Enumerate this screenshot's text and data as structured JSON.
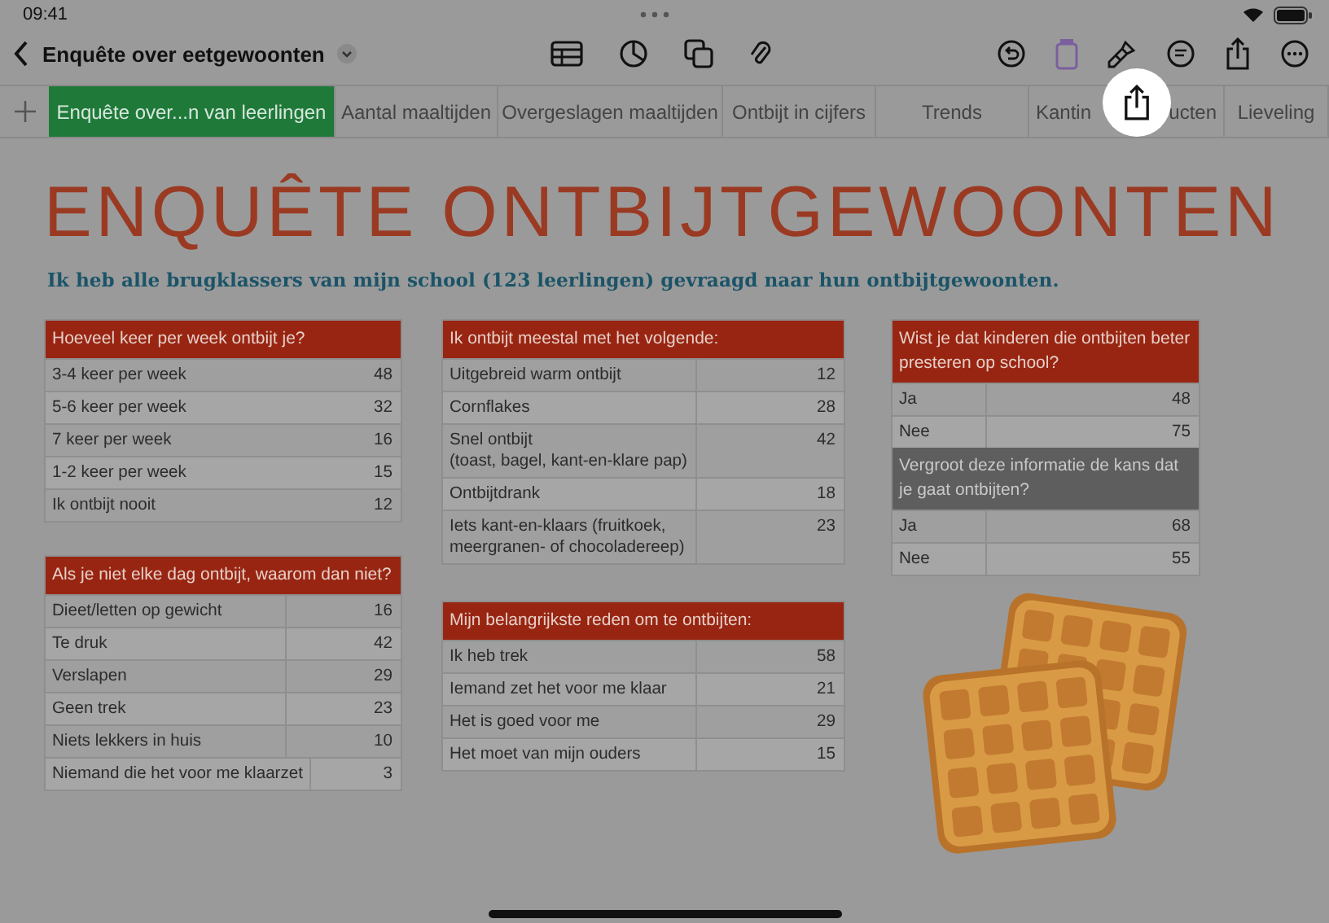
{
  "status_bar": {
    "time": "09:41"
  },
  "toolbar": {
    "title": "Enquête over eetgewoonten",
    "share_highlighted": true
  },
  "sheet_tabs": [
    {
      "label": "Enquête over...n van leerlingen",
      "selected": true
    },
    {
      "label": "Aantal maaltijden",
      "selected": false
    },
    {
      "label": "Overgeslagen maaltijden",
      "selected": false
    },
    {
      "label": "Ontbijt in cijfers",
      "selected": false
    },
    {
      "label": "Trends",
      "selected": false
    },
    {
      "label": "Kantin",
      "label_end": "ucten",
      "selected": false
    },
    {
      "label": "Lieveling",
      "selected": false
    }
  ],
  "title": "ENQUÊTE ONTBIJTGEWOONTEN",
  "subtitle": "Ik heb alle brugklassers van mijn school (123 leerlingen) gevraagd naar hun ontbijtgewoonten.",
  "columns": [
    [
      {
        "divided": false,
        "sections": [
          {
            "header": "Hoeveel keer per week ontbijt je?",
            "kind": "accent",
            "rows": [
              {
                "label": "3-4 keer per week",
                "value": "48"
              },
              {
                "label": "5-6 keer per week",
                "value": "32"
              },
              {
                "label": "7 keer per week",
                "value": "16"
              },
              {
                "label": "1-2 keer per week",
                "value": "15"
              },
              {
                "label": "Ik ontbijt nooit",
                "value": "12"
              }
            ]
          }
        ]
      },
      {
        "divided": true,
        "sections": [
          {
            "header": "Als je niet elke dag ontbijt, waarom dan niet?",
            "kind": "accent",
            "rows": [
              {
                "label": "Dieet/letten op gewicht",
                "value": "16"
              },
              {
                "label": "Te druk",
                "value": "42"
              },
              {
                "label": "Verslapen",
                "value": "29"
              },
              {
                "label": "Geen trek",
                "value": "23"
              },
              {
                "label": "Niets lekkers in huis",
                "value": "10"
              },
              {
                "label": "Niemand die het voor me klaarzet",
                "value": "3"
              }
            ]
          }
        ]
      }
    ],
    [
      {
        "divided": true,
        "sections": [
          {
            "header": "Ik ontbijt meestal met het volgende:",
            "kind": "accent",
            "rows": [
              {
                "label": "Uitgebreid warm ontbijt",
                "value": "12"
              },
              {
                "label": "Cornflakes",
                "value": "28"
              },
              {
                "label": "Snel ontbijt\n(toast, bagel, kant-en-klare pap)",
                "value": "42"
              },
              {
                "label": "Ontbijtdrank",
                "value": "18"
              },
              {
                "label": "Iets kant-en-klaars (fruitkoek,\nmeergranen- of chocoladereep)",
                "value": "23"
              }
            ]
          }
        ]
      },
      {
        "divided": true,
        "sections": [
          {
            "header": "Mijn belangrijkste reden om te ontbijten:",
            "kind": "accent",
            "rows": [
              {
                "label": "Ik heb trek",
                "value": "58"
              },
              {
                "label": "Iemand zet het voor me klaar",
                "value": "21"
              },
              {
                "label": "Het is goed voor me",
                "value": "29"
              },
              {
                "label": "Het moet van mijn ouders",
                "value": "15"
              }
            ]
          }
        ]
      }
    ],
    [
      {
        "divided": true,
        "sections": [
          {
            "header": "Wist je dat kinderen die ontbijten beter presteren op school?",
            "kind": "accent",
            "rows": [
              {
                "label": "Ja",
                "value": "48"
              },
              {
                "label": "Nee",
                "value": "75"
              }
            ]
          },
          {
            "header": "Vergroot deze informatie de kans dat je gaat ontbijten?",
            "kind": "dark",
            "rows": [
              {
                "label": "Ja",
                "value": "68"
              },
              {
                "label": "Nee",
                "value": "55"
              }
            ]
          }
        ]
      },
      {
        "kind": "picture"
      }
    ]
  ]
}
